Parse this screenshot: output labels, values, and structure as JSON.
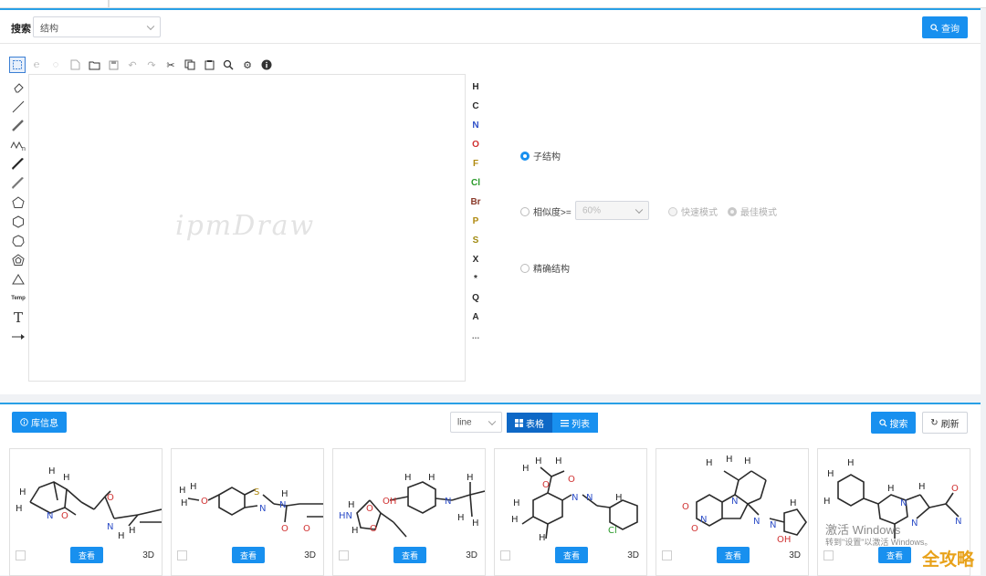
{
  "search": {
    "label": "搜索",
    "type_value": "结构",
    "query_button": "查询"
  },
  "editor": {
    "watermark": "ipmDraw",
    "top_tools": [
      "select-icon",
      "lasso-icon",
      "erase-tool-icon",
      "new-file-icon",
      "open-folder-icon",
      "save-icon",
      "undo-icon",
      "redo-icon",
      "cut-icon",
      "copy-icon",
      "paste-icon",
      "zoom-icon",
      "settings-icon",
      "info-icon"
    ],
    "left_tools": [
      "eraser-icon",
      "single-bond-icon",
      "double-bond-icon",
      "chain-icon",
      "wedge-bond-icon",
      "hash-bond-icon",
      "pentagon-icon",
      "hexagon-icon",
      "heptagon-icon",
      "cyclopentadiene-icon",
      "triangle-icon",
      "template-icon",
      "text-icon",
      "arrow-icon"
    ],
    "template_label": "Temp",
    "text_tool_label": "T",
    "elements": [
      "H",
      "C",
      "N",
      "O",
      "F",
      "Cl",
      "Br",
      "P",
      "S",
      "X",
      "*",
      "Q",
      "A",
      "..."
    ],
    "element_colors": [
      "#2b2b2b",
      "#2b2b2b",
      "#3050c8",
      "#d03030",
      "#b08a10",
      "#2a9a2a",
      "#8a3a2a",
      "#b08a10",
      "#a08a10",
      "#2b2b2b",
      "#2b2b2b",
      "#2b2b2b",
      "#2b2b2b",
      "#777777"
    ]
  },
  "options": {
    "substructure": "子结构",
    "similarity": "相似度>=",
    "similarity_value": "60%",
    "fast_mode": "快速模式",
    "best_mode": "最佳模式",
    "exact": "精确结构"
  },
  "results": {
    "lib_info": "库信息",
    "line_value": "line",
    "table_view": "表格",
    "list_view": "列表",
    "search_button": "搜索",
    "refresh_button": "刷新",
    "cards": [
      {
        "view": "查看",
        "d3": "3D"
      },
      {
        "view": "查看",
        "d3": "3D"
      },
      {
        "view": "查看",
        "d3": "3D"
      },
      {
        "view": "查看",
        "d3": "3D"
      },
      {
        "view": "查看",
        "d3": "3D"
      },
      {
        "view": "查看",
        "d3": ""
      }
    ]
  },
  "os_watermark": {
    "line1": "激活 Windows",
    "line2": "转到\"设置\"以激活 Windows。"
  },
  "logo_watermark": "全攻略",
  "colors": {
    "accent": "#1890ef",
    "panel_border": "#29a0e6",
    "atom_n": "#3050c8",
    "atom_o": "#d03030",
    "atom_s": "#b08a10",
    "atom_cl": "#2a9a2a"
  }
}
